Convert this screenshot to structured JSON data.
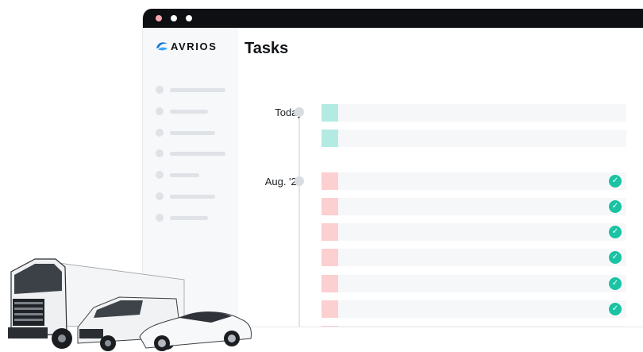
{
  "app": {
    "brand": "AVRIOS",
    "colors": {
      "accent": "#19c3a3",
      "upcoming": "#b3ebe3",
      "past": "#fccfd0",
      "titlebar": "#0d0f12"
    }
  },
  "window": {
    "controls": [
      "close",
      "minimize",
      "maximize"
    ]
  },
  "sidebar": {
    "item_count": 7
  },
  "main": {
    "title": "Tasks",
    "groups": [
      {
        "label": "Today",
        "status": "upcoming",
        "task_count": 2,
        "completed": false
      },
      {
        "label": "Aug. '22",
        "status": "past",
        "task_count": 6,
        "completed": true
      }
    ]
  },
  "icons": {
    "logo": "avrios-logo-icon",
    "check": "check-circle-icon",
    "vehicles": "vehicles-illustration"
  }
}
